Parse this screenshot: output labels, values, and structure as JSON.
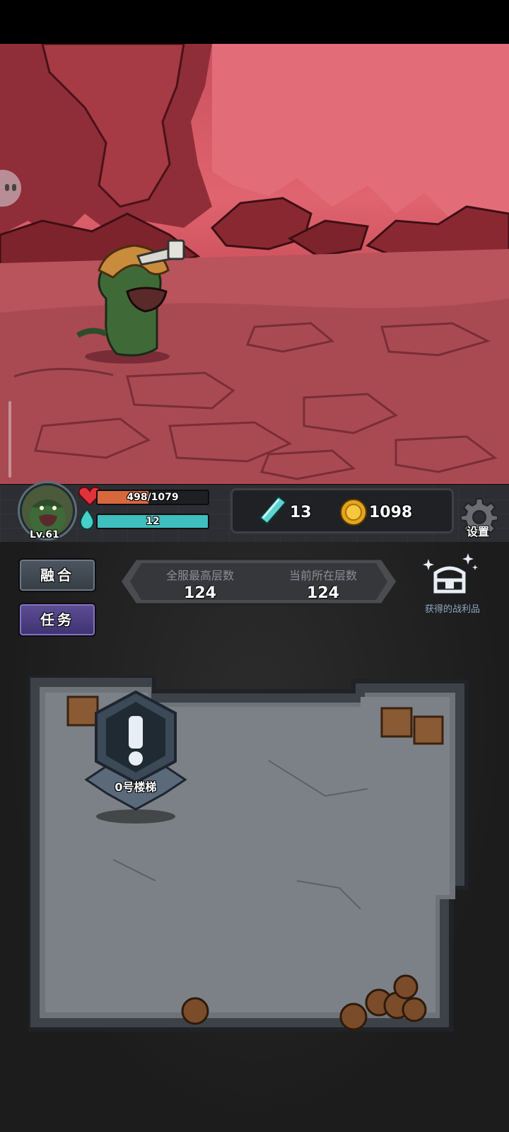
{
  "hero": {
    "level": "Lv.61"
  },
  "hp": {
    "text": "498/1079",
    "current": 498,
    "max": 1079
  },
  "mana": {
    "text": "12",
    "fill": 1.0
  },
  "resources": {
    "crystals": "13",
    "gold": "1098"
  },
  "settings": {
    "label": "设置"
  },
  "buttons": {
    "fusion": "融合",
    "tasks": "任务"
  },
  "floors": {
    "best_label": "全服最高层数",
    "best_value": "124",
    "current_label": "当前所在层数",
    "current_value": "124"
  },
  "loot": {
    "label": "获得的战利品"
  },
  "map": {
    "marker_label": "0号楼梯"
  },
  "colors": {
    "hp": "#d9673d",
    "mana": "#3fbfbf",
    "scene": "#d45a66",
    "task_button": "#4a3d85"
  }
}
